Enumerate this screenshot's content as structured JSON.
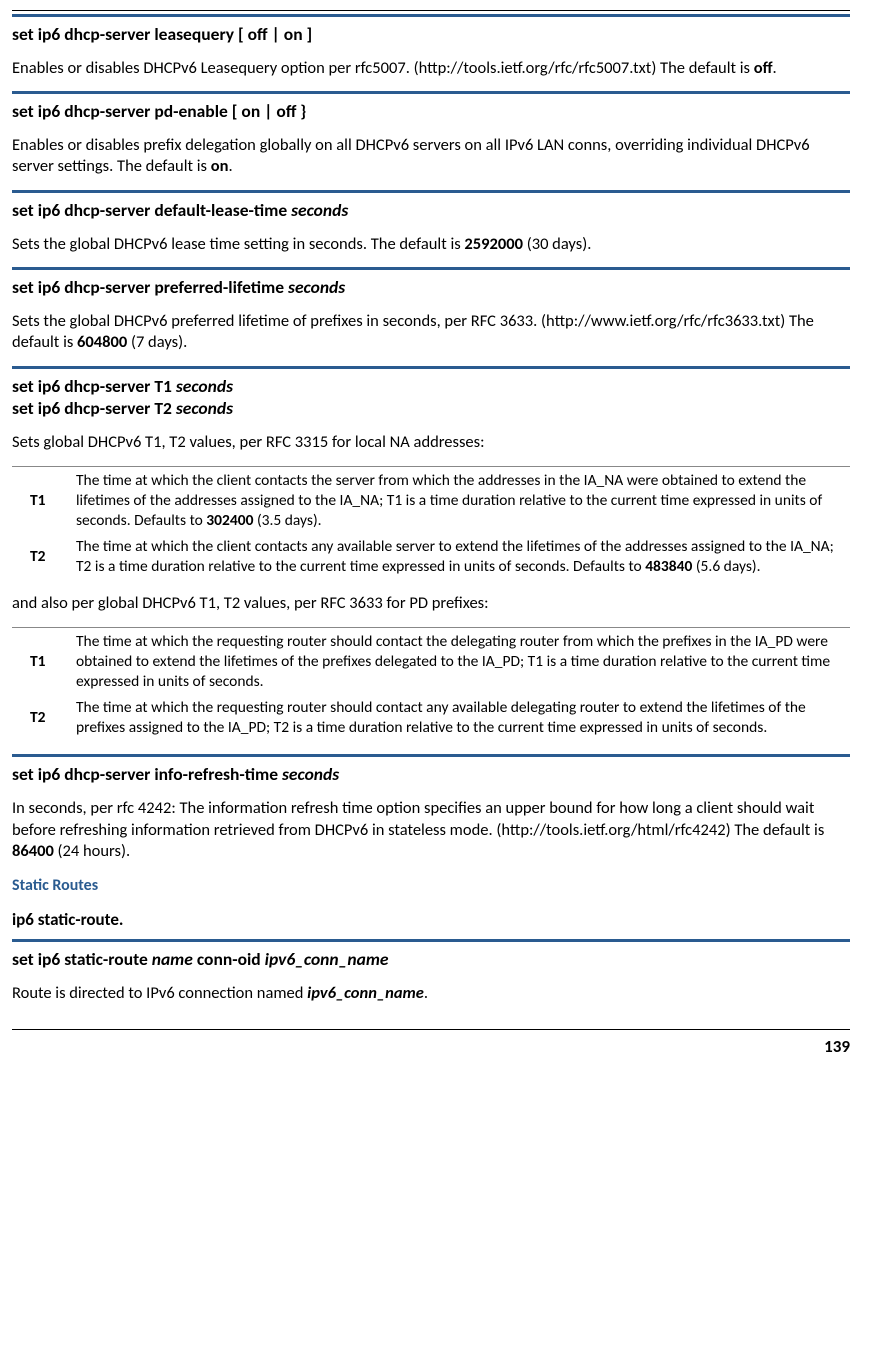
{
  "sections": [
    {
      "heading_parts": [
        {
          "t": "set ip6 dhcp-server leasequery [ off | on ]",
          "b": true
        }
      ],
      "desc_parts": [
        {
          "t": "Enables or disables DHCPv6 Leasequery option per rfc5007. (http://tools.ietf.org/rfc/rfc5007.txt) The default is "
        },
        {
          "t": "off",
          "b": true
        },
        {
          "t": "."
        }
      ]
    },
    {
      "heading_parts": [
        {
          "t": "set ip6 dhcp-server pd-enable [ on | off }",
          "b": true
        }
      ],
      "desc_parts": [
        {
          "t": "Enables or disables prefix delegation globally on all DHCPv6 servers on all IPv6 LAN conns, overriding individual DHCPv6 server settings. The default is "
        },
        {
          "t": "on",
          "b": true
        },
        {
          "t": "."
        }
      ]
    },
    {
      "heading_parts": [
        {
          "t": "set ip6 dhcp-server default-lease-time ",
          "b": true
        },
        {
          "t": "seconds",
          "b": true,
          "i": true
        }
      ],
      "desc_parts": [
        {
          "t": "Sets the global DHCPv6 lease time setting in seconds. The default is "
        },
        {
          "t": "2592000",
          "b": true
        },
        {
          "t": " (30 days)."
        }
      ]
    },
    {
      "heading_parts": [
        {
          "t": "set ip6 dhcp-server preferred-lifetime ",
          "b": true
        },
        {
          "t": "seconds",
          "b": true,
          "i": true
        }
      ],
      "desc_parts": [
        {
          "t": "Sets the global DHCPv6 preferred lifetime of prefixes in seconds, per RFC 3633. (http://www.ietf.org/rfc/rfc3633.txt) The default is "
        },
        {
          "t": "604800",
          "b": true
        },
        {
          "t": " (7 days)."
        }
      ]
    }
  ],
  "t1t2": {
    "heading_lines": [
      [
        {
          "t": "set ip6 dhcp-server T1 ",
          "b": true
        },
        {
          "t": "seconds",
          "b": true,
          "i": true
        }
      ],
      [
        {
          "t": "set ip6 dhcp-server T2 ",
          "b": true
        },
        {
          "t": "seconds",
          "b": true,
          "i": true
        }
      ]
    ],
    "intro1": "Sets global DHCPv6 T1, T2 values, per RFC 3315 for local NA addresses:",
    "table1": [
      {
        "key": "T1",
        "parts": [
          {
            "t": "The time at which the client contacts the server from which the addresses in the IA_NA were obtained to extend the lifetimes of the addresses assigned to the IA_NA; T1 is a time duration relative to the current time expressed in units of seconds. Defaults to "
          },
          {
            "t": "302400",
            "b": true
          },
          {
            "t": " (3.5 days)."
          }
        ]
      },
      {
        "key": "T2",
        "parts": [
          {
            "t": "The time at which the client contacts any available server to extend the lifetimes of the addresses assigned to the IA_NA; T2 is a time duration relative to the current time expressed in units of seconds. Defaults to "
          },
          {
            "t": "483840",
            "b": true
          },
          {
            "t": " (5.6 days)."
          }
        ]
      }
    ],
    "intro2": "and also per global DHCPv6 T1, T2 values, per RFC 3633 for PD prefixes:",
    "table2": [
      {
        "key": "T1",
        "parts": [
          {
            "t": "The time at which the requesting router should contact the delegating router from which the prefixes in the IA_PD were obtained to extend the lifetimes of the prefixes delegated to the IA_PD; T1 is a time duration relative to the current time expressed in units of seconds."
          }
        ]
      },
      {
        "key": "T2",
        "parts": [
          {
            "t": "The time at which the requesting router should contact any available delegating router to extend the lifetimes of the prefixes assigned to the IA_PD; T2 is a time duration relative to the current time expressed in units of seconds."
          }
        ]
      }
    ]
  },
  "info_refresh": {
    "heading_parts": [
      {
        "t": "set ip6 dhcp-server info-refresh-time ",
        "b": true
      },
      {
        "t": "seconds",
        "b": true,
        "i": true
      }
    ],
    "desc_parts": [
      {
        "t": "In seconds, per rfc 4242: The information refresh time option specifies an upper bound for how long a client should wait before refreshing information retrieved from DHCPv6 in stateless mode. (http://tools.ietf.org/html/rfc4242) The default is "
      },
      {
        "t": "86400",
        "b": true
      },
      {
        "t": " (24 hours)."
      }
    ]
  },
  "static_routes_label": "Static Routes",
  "static_route_plainhead": "ip6 static-route.",
  "conn_oid": {
    "heading_parts": [
      {
        "t": "set ip6 static-route ",
        "b": true
      },
      {
        "t": "name",
        "b": true,
        "i": true
      },
      {
        "t": " conn-oid ",
        "b": true
      },
      {
        "t": "ipv6_conn_name",
        "b": true,
        "i": true
      }
    ],
    "desc_parts": [
      {
        "t": "Route is directed to IPv6 connection named "
      },
      {
        "t": "ipv6_conn_name",
        "b": true,
        "i": true
      },
      {
        "t": "."
      }
    ]
  },
  "page_number": "139"
}
